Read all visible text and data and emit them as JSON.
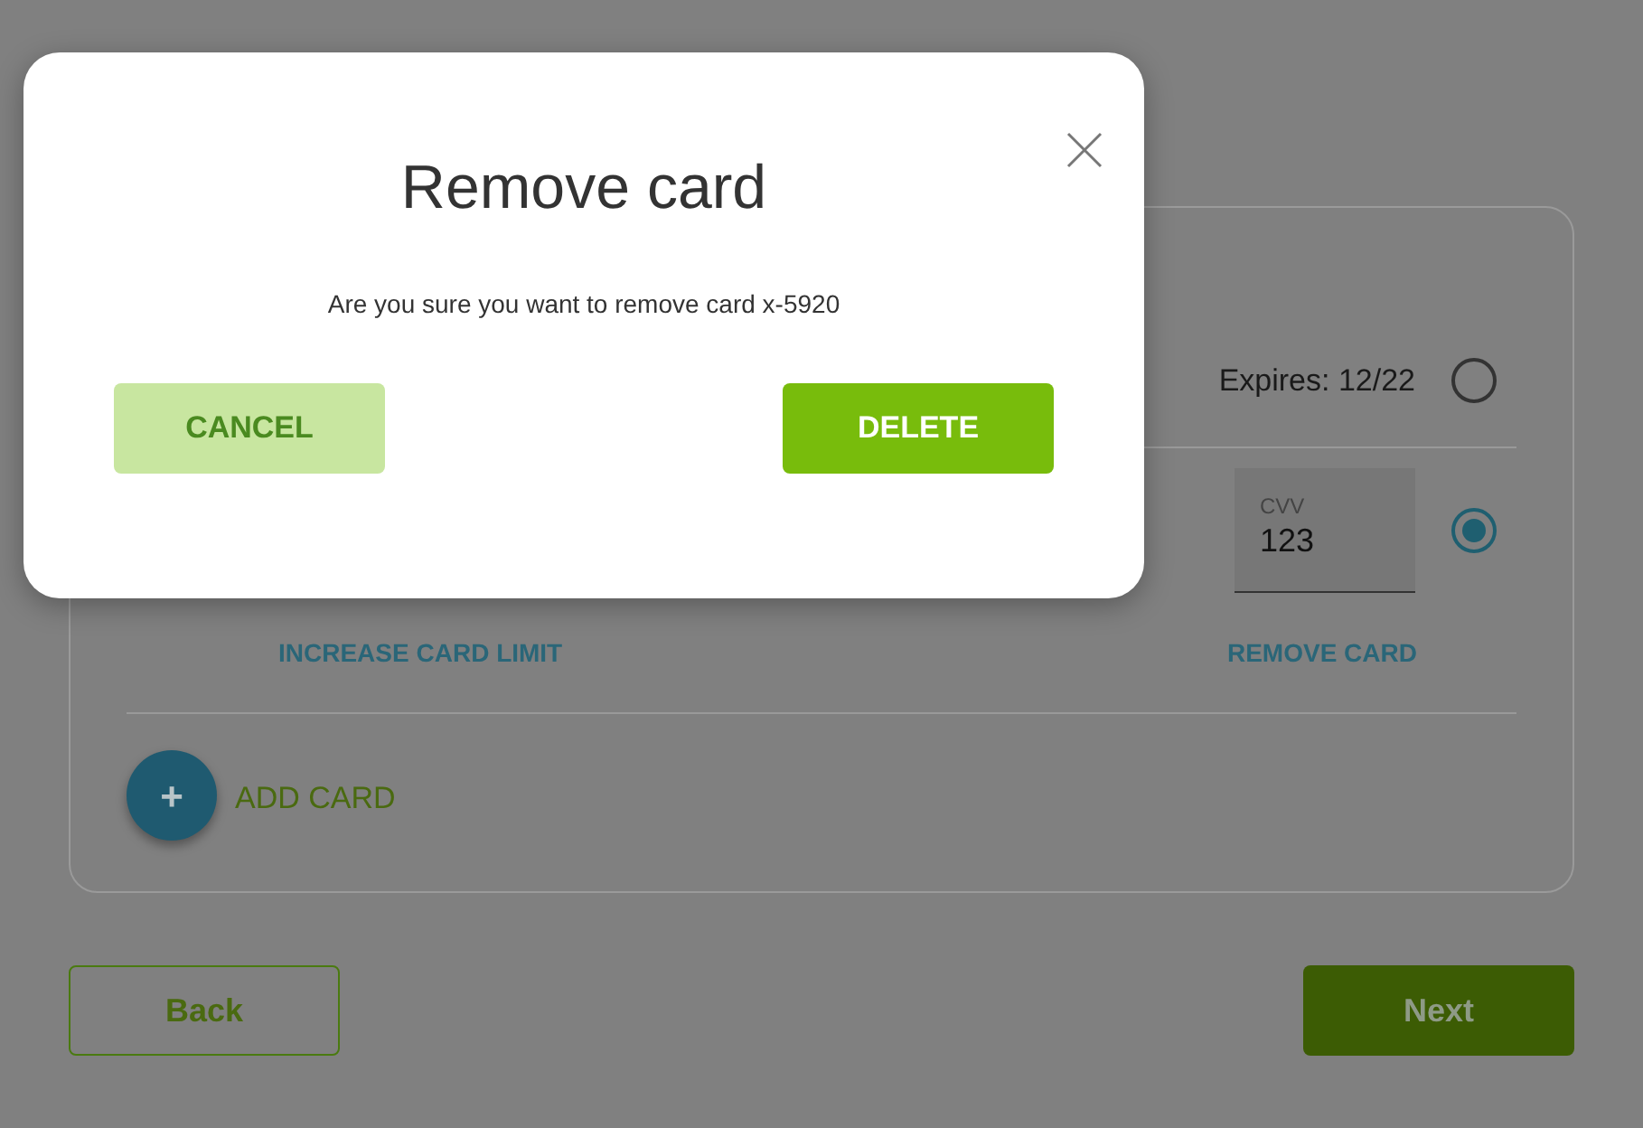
{
  "page": {
    "cards": [
      {
        "kind": "expiry",
        "expires": "Expires: 12/22",
        "selected": false
      },
      {
        "kind": "cvv",
        "cvv_label": "CVV",
        "cvv_value": "123",
        "selected": true,
        "actions": [
          "INCREASE CARD LIMIT",
          "REMOVE CARD"
        ]
      }
    ],
    "add_card": {
      "icon": "+",
      "label": "ADD CARD"
    },
    "nav": [
      {
        "label": "Back",
        "kind": "outline"
      },
      {
        "label": "Next",
        "kind": "filled"
      }
    ]
  },
  "dialog": {
    "title": "Remove card",
    "message": "Are you sure you want to remove card x-5920",
    "buttons": [
      {
        "label": "CANCEL",
        "kind": "secondary"
      },
      {
        "label": "DELETE",
        "kind": "primary"
      }
    ]
  }
}
